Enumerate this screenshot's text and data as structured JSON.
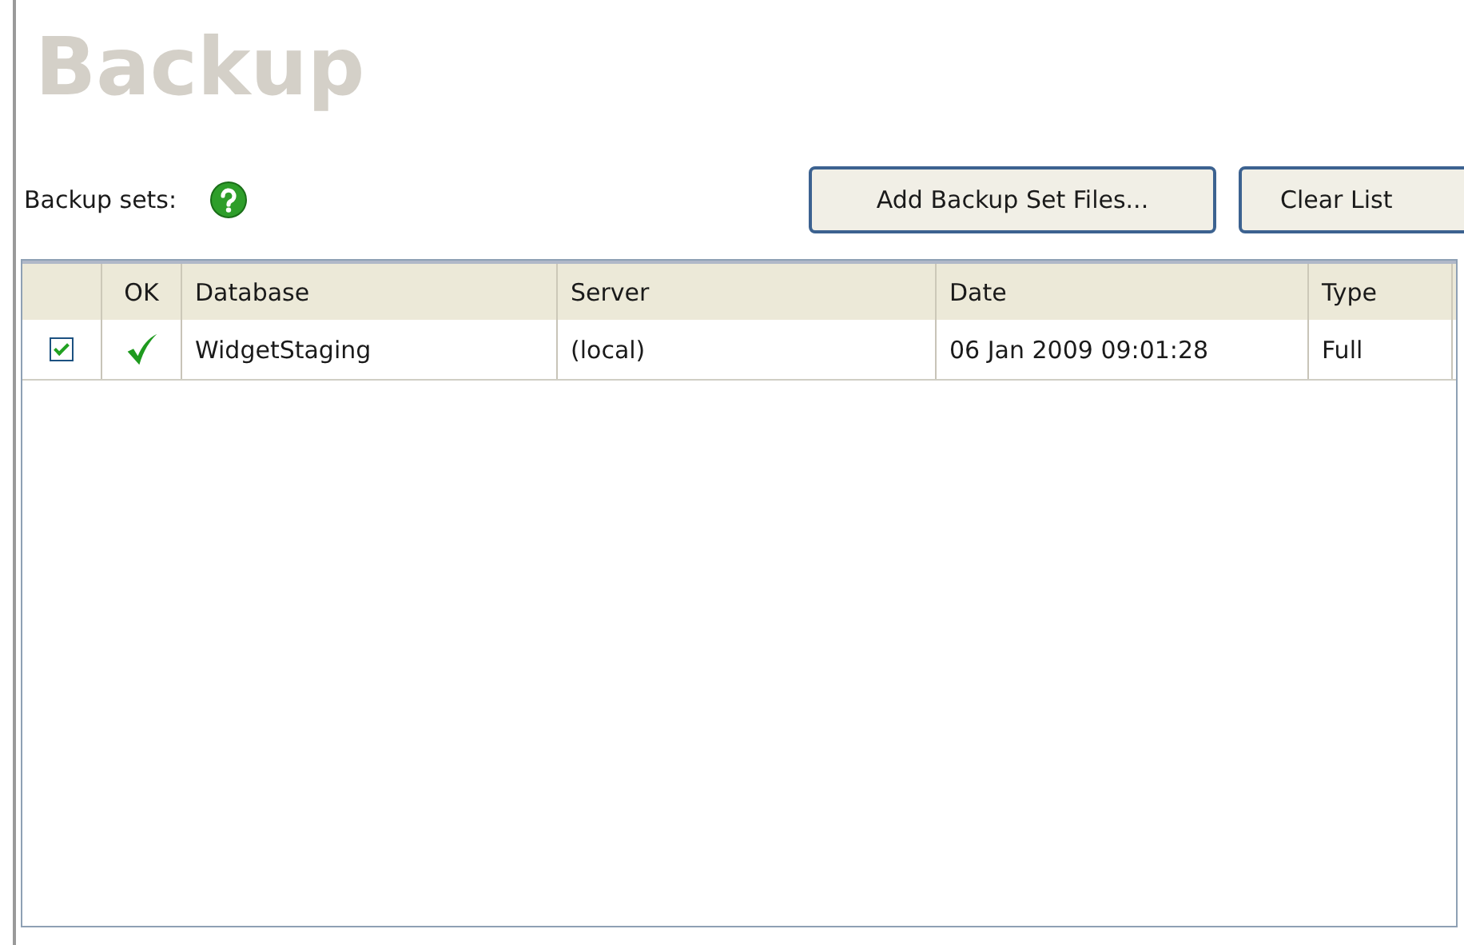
{
  "title": "Backup",
  "backup_sets": {
    "label": "Backup sets:"
  },
  "buttons": [
    "Add Backup Set Files...",
    "Clear List"
  ],
  "table": {
    "columns": [
      "",
      "OK",
      "Database",
      "Server",
      "Date",
      "Type"
    ],
    "rows": [
      {
        "checked": true,
        "ok": true,
        "database": "WidgetStaging",
        "server": "(local)",
        "date": "06 Jan 2009 09:01:28",
        "type": "Full"
      }
    ]
  }
}
